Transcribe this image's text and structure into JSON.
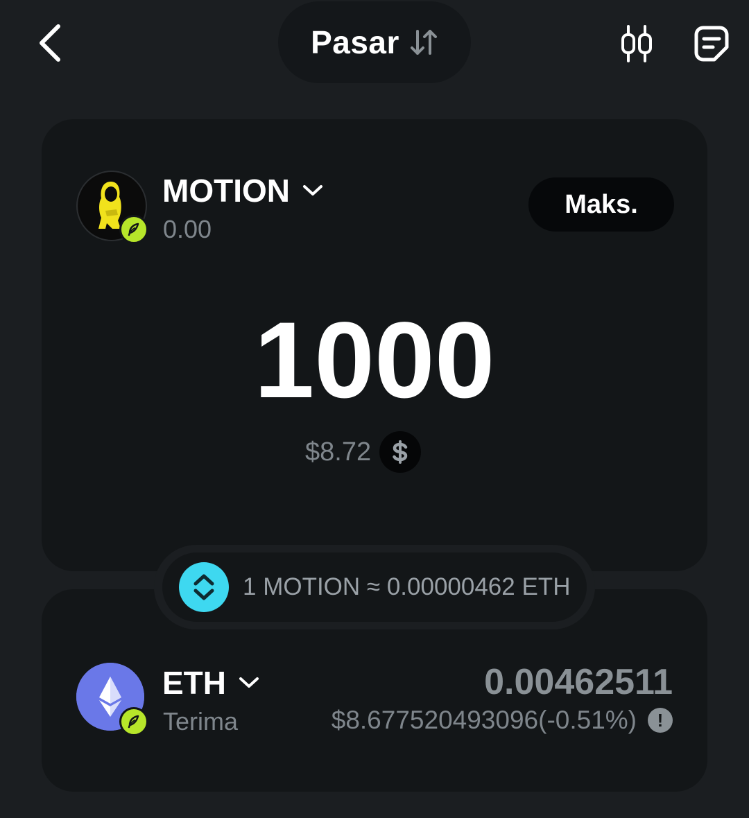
{
  "header": {
    "mode_label": "Pasar",
    "icons": [
      "back-arrow-icon",
      "swap-order-icon",
      "candlestick-chart-icon",
      "history-icon"
    ]
  },
  "from": {
    "token": "MOTION",
    "balance": "0.00",
    "max_label": "Maks.",
    "amount": "1000",
    "usd_value": "$8.72",
    "currency_icon": "dollar-icon"
  },
  "rate": {
    "text": "1 MOTION ≈ 0.00000462 ETH"
  },
  "to": {
    "token": "ETH",
    "label": "Terima",
    "amount": "0.00462511",
    "usd_value": "$8.677520493096(-0.51%)",
    "warning_icon": "!"
  },
  "colors": {
    "background": "#1b1e21",
    "card": "#131618",
    "accent_cyan": "#3ed8f0",
    "chain_badge": "#b7e62a",
    "eth_purple": "#6a78e8",
    "muted_text": "#7f868c"
  }
}
